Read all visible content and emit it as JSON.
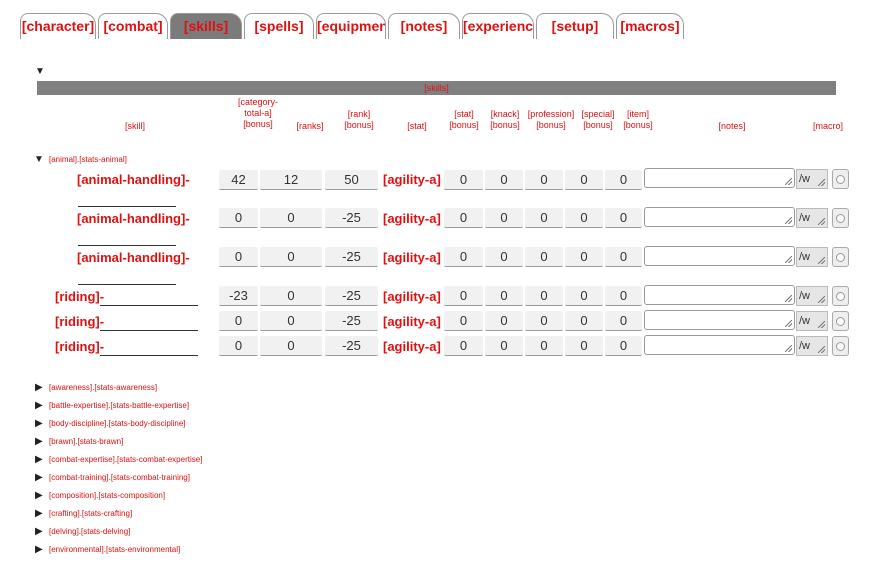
{
  "tabs": [
    {
      "label": "[character]"
    },
    {
      "label": "[combat]"
    },
    {
      "label": "[skills]"
    },
    {
      "label": "[spells]"
    },
    {
      "label": "[equipment]"
    },
    {
      "label": "[notes]"
    },
    {
      "label": "[experience]"
    },
    {
      "label": "[setup]"
    },
    {
      "label": "[macros]"
    }
  ],
  "active_tab": "[skills]",
  "section_bar": "[skills]",
  "icons": {
    "expand": "▼",
    "collapse": "▶"
  },
  "headers": {
    "skill": "[skill]",
    "category": "[category-\ntotal-a]\n[bonus]",
    "ranks": "[ranks]",
    "rank_bonus": "[rank]\n[bonus]",
    "stat": "[stat]",
    "stat_bonus": "[stat]\n[bonus]",
    "knack_bonus": "[knack]\n[bonus]",
    "profession_bonus": "[profession]\n[bonus]",
    "special_bonus": "[special]\n[bonus]",
    "item_bonus": "[item]\n[bonus]",
    "notes": "[notes]",
    "macro": "[macro]"
  },
  "animal_group": {
    "name": "[animal]",
    "sep": ".",
    "stats": "[stats-animal]"
  },
  "rows": [
    {
      "skill": "[animal-handling]-",
      "category": "42",
      "ranks": "12",
      "rank_bonus": "50",
      "stat": "[agility-a]",
      "stat_bonus": "0",
      "knack": "0",
      "profession": "0",
      "special": "0",
      "item": "0",
      "macro_w": "/w"
    },
    {
      "skill": "[animal-handling]-",
      "category": "0",
      "ranks": "0",
      "rank_bonus": "-25",
      "stat": "[agility-a]",
      "stat_bonus": "0",
      "knack": "0",
      "profession": "0",
      "special": "0",
      "item": "0",
      "macro_w": "/w"
    },
    {
      "skill": "[animal-handling]-",
      "category": "0",
      "ranks": "0",
      "rank_bonus": "-25",
      "stat": "[agility-a]",
      "stat_bonus": "0",
      "knack": "0",
      "profession": "0",
      "special": "0",
      "item": "0",
      "macro_w": "/w"
    },
    {
      "skill": "[riding]-",
      "category": "-23",
      "ranks": "0",
      "rank_bonus": "-25",
      "stat": "[agility-a]",
      "stat_bonus": "0",
      "knack": "0",
      "profession": "0",
      "special": "0",
      "item": "0",
      "macro_w": "/w"
    },
    {
      "skill": "[riding]-",
      "category": "0",
      "ranks": "0",
      "rank_bonus": "-25",
      "stat": "[agility-a]",
      "stat_bonus": "0",
      "knack": "0",
      "profession": "0",
      "special": "0",
      "item": "0",
      "macro_w": "/w"
    },
    {
      "skill": "[riding]-",
      "category": "0",
      "ranks": "0",
      "rank_bonus": "-25",
      "stat": "[agility-a]",
      "stat_bonus": "0",
      "knack": "0",
      "profession": "0",
      "special": "0",
      "item": "0",
      "macro_w": "/w"
    }
  ],
  "collapsed_groups": [
    {
      "name": "[awareness]",
      "stats": "[stats-awareness]"
    },
    {
      "name": "[battle-expertise]",
      "stats": "[stats-battle-expertise]"
    },
    {
      "name": "[body-discipline]",
      "stats": "[stats-body-discipline]"
    },
    {
      "name": "[brawn]",
      "stats": "[stats-brawn]"
    },
    {
      "name": "[combat-expertise]",
      "stats": "[stats-combat-expertise]"
    },
    {
      "name": "[combat-training]",
      "stats": "[stats-combat-training]"
    },
    {
      "name": "[composition]",
      "stats": "[stats-composition]"
    },
    {
      "name": "[crafting]",
      "stats": "[stats-crafting]"
    },
    {
      "name": "[delving]",
      "stats": "[stats-delving]"
    },
    {
      "name": "[environmental]",
      "stats": "[stats-environmental]"
    }
  ],
  "colors": {
    "accent": "#e01010",
    "active_tab_bg": "#7b7b7b",
    "bar_bg": "#808080"
  }
}
